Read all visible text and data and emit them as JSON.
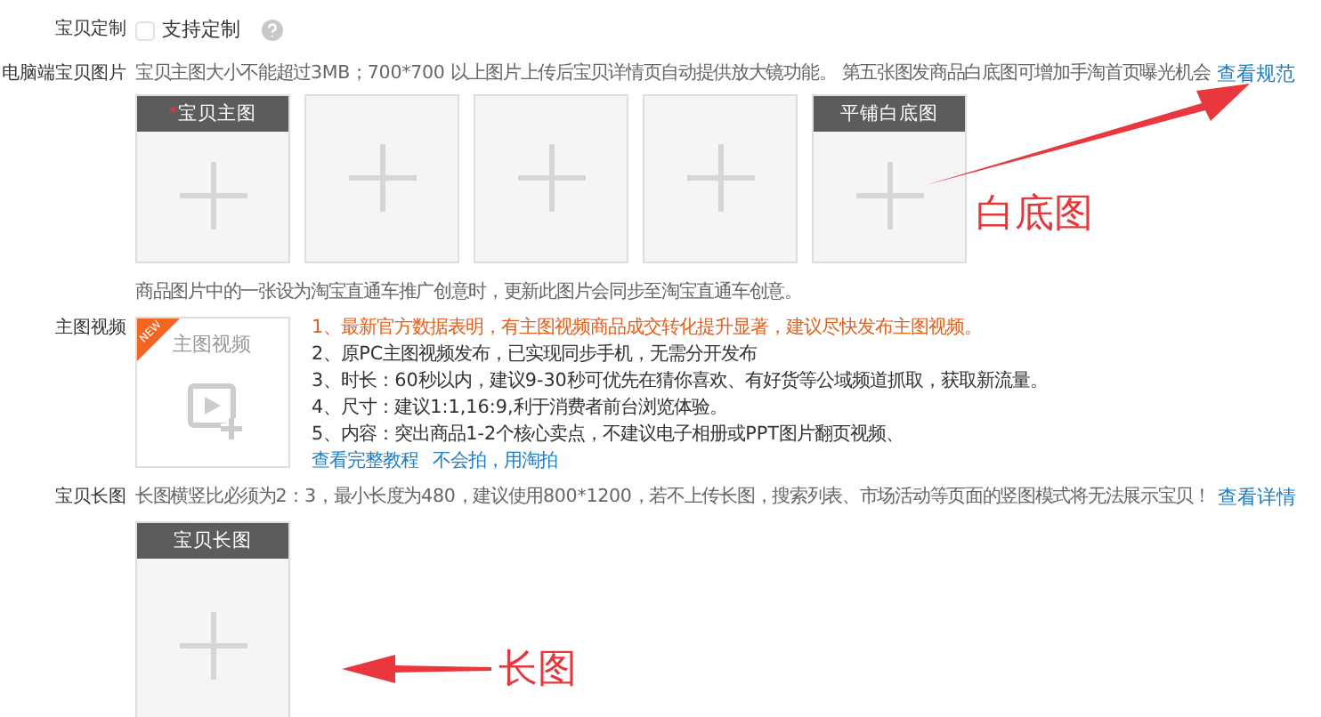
{
  "customization": {
    "label": "宝贝定制",
    "checkbox_label": "支持定制",
    "checked": false
  },
  "pc_images": {
    "label": "电脑端宝贝图片",
    "hint": "宝贝主图大小不能超过3MB；700*700 以上图片上传后宝贝详情页自动提供放大镜功能。 第五张图发商品白底图可增加手淘首页曝光机会",
    "link": "查看规范",
    "slots": [
      {
        "kind": "titled",
        "title": "宝贝主图",
        "mark": "*"
      },
      {
        "kind": "empty"
      },
      {
        "kind": "empty"
      },
      {
        "kind": "empty"
      },
      {
        "kind": "titled",
        "title": "平铺白底图"
      }
    ]
  },
  "annotation_white": "白底图",
  "note": "商品图片中的一张设为淘宝直通车推广创意时，更新此图片会同步至淘宝直通车创意。",
  "video": {
    "label": "主图视频",
    "badge": "NEW",
    "box_title": "主图视频",
    "lines": [
      {
        "kind": "highlight",
        "text": "1、最新官方数据表明，有主图视频商品成交转化提升显著，建议尽快发布主图视频。"
      },
      {
        "kind": "plain",
        "text": "2、原PC主图视频发布，已实现同步手机，无需分开发布"
      },
      {
        "kind": "plain",
        "text": "3、时长：60秒以内，建议9-30秒可优先在猜你喜欢、有好货等公域频道抓取，获取新流量。"
      },
      {
        "kind": "plain",
        "text": "4、尺寸：建议1:1,16:9,利于消费者前台浏览体验。"
      },
      {
        "kind": "plain",
        "text": "5、内容：突出商品1-2个核心卖点，不建议电子相册或PPT图片翻页视频、"
      }
    ],
    "links": [
      "查看完整教程",
      "不会拍，用淘拍"
    ]
  },
  "long_image": {
    "label": "宝贝长图",
    "hint": "长图横竖比必须为2：3，最小长度为480，建议使用800*1200，若不上传长图，搜索列表、市场活动等页面的竖图模式将无法展示宝贝！",
    "link": "查看详情",
    "slot_title": "宝贝长图"
  },
  "annotation_long": "长图"
}
